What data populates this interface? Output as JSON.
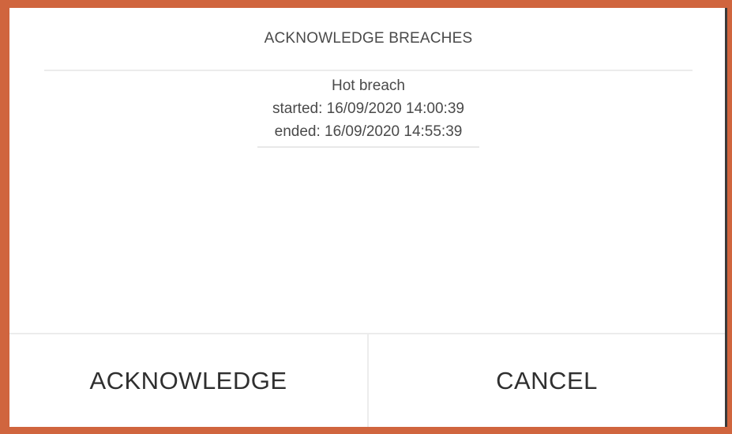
{
  "dialog": {
    "title": "ACKNOWLEDGE BREACHES",
    "breaches": [
      {
        "type": "Hot breach",
        "started": "started: 16/09/2020 14:00:39",
        "ended": "ended: 16/09/2020 14:55:39"
      }
    ],
    "acknowledge_label": "ACKNOWLEDGE",
    "cancel_label": "CANCEL"
  },
  "colors": {
    "frame_border": "#d0653e",
    "text": "#4a4a4a",
    "button_text": "#2f2f2f",
    "divider": "#ececec"
  }
}
